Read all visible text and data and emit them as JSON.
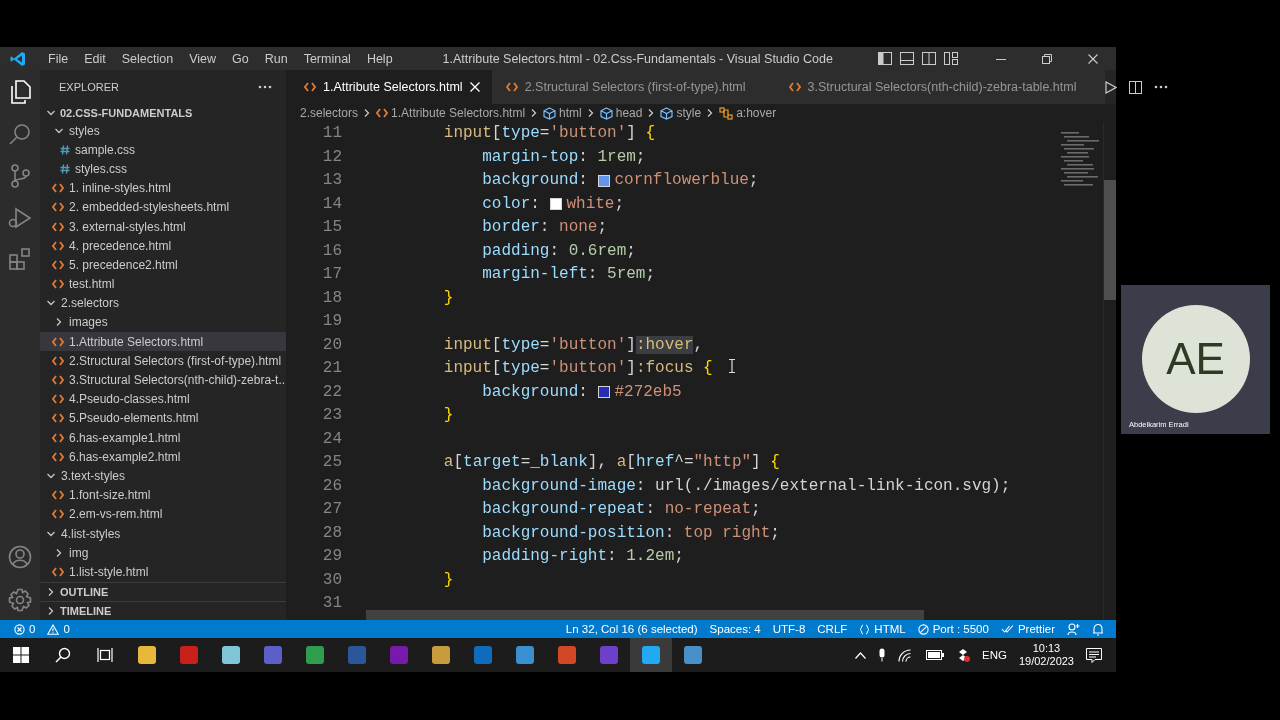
{
  "window": {
    "menu": [
      "File",
      "Edit",
      "Selection",
      "View",
      "Go",
      "Run",
      "Terminal",
      "Help"
    ],
    "title": "1.Attribute Selectors.html - 02.Css-Fundamentals - Visual Studio Code"
  },
  "explorer": {
    "title": "EXPLORER",
    "root": {
      "label": "02.CSS-FUNDAMENTALS",
      "expanded": true
    },
    "tree": [
      {
        "children": [
          {
            "label": "styles",
            "kind": "folder",
            "expanded": true,
            "selected": false,
            "children": [
              {
                "label": "sample.css",
                "kind": "css",
                "selected": false
              },
              {
                "label": "styles.css",
                "kind": "css",
                "selected": false
              }
            ]
          },
          {
            "label": "1. inline-styles.html",
            "kind": "html",
            "selected": false
          },
          {
            "label": "2. embedded-stylesheets.html",
            "kind": "html",
            "selected": false
          },
          {
            "label": "3. external-styles.html",
            "kind": "html",
            "selected": false
          },
          {
            "label": "4. precedence.html",
            "kind": "html",
            "selected": false
          },
          {
            "label": "5. precedence2.html",
            "kind": "html",
            "selected": false
          },
          {
            "label": "test.html",
            "kind": "html",
            "selected": false
          }
        ]
      },
      {
        "label": "2.selectors",
        "kind": "folder",
        "expanded": true,
        "selected": false,
        "children": [
          {
            "label": "images",
            "kind": "folder",
            "expanded": false,
            "selected": false
          },
          {
            "label": "1.Attribute Selectors.html",
            "kind": "html",
            "selected": true
          },
          {
            "label": "2.Structural Selectors (first-of-type).html",
            "kind": "html",
            "selected": false
          },
          {
            "label": "3.Structural Selectors(nth-child)-zebra-t...",
            "kind": "html",
            "selected": false
          },
          {
            "label": "4.Pseudo-classes.html",
            "kind": "html",
            "selected": false
          },
          {
            "label": "5.Pseudo-elements.html",
            "kind": "html",
            "selected": false
          },
          {
            "label": "6.has-example1.html",
            "kind": "html",
            "selected": false
          },
          {
            "label": "6.has-example2.html",
            "kind": "html",
            "selected": false
          }
        ]
      },
      {
        "label": "3.text-styles",
        "kind": "folder",
        "expanded": true,
        "selected": false,
        "children": [
          {
            "label": "1.font-size.html",
            "kind": "html",
            "selected": false
          },
          {
            "label": "2.em-vs-rem.html",
            "kind": "html",
            "selected": false
          }
        ]
      },
      {
        "label": "4.list-styles",
        "kind": "folder",
        "expanded": true,
        "selected": false,
        "children": [
          {
            "label": "img",
            "kind": "folder",
            "expanded": false,
            "selected": false
          },
          {
            "label": "1.list-style.html",
            "kind": "html",
            "selected": false
          }
        ]
      }
    ],
    "sections": [
      {
        "label": "OUTLINE",
        "expanded": false
      },
      {
        "label": "TIMELINE",
        "expanded": false
      }
    ]
  },
  "tabs": [
    {
      "label": "1.Attribute Selectors.html",
      "selected": true
    },
    {
      "label": "2.Structural Selectors (first-of-type).html",
      "selected": false
    },
    {
      "label": "3.Structural Selectors(nth-child)-zebra-table.html",
      "selected": false
    }
  ],
  "breadcrumbs": [
    {
      "label": "2.selectors",
      "kind": "folder"
    },
    {
      "label": "1.Attribute Selectors.html",
      "kind": "html"
    },
    {
      "label": "html",
      "kind": "element"
    },
    {
      "label": "head",
      "kind": "element"
    },
    {
      "label": "style",
      "kind": "element"
    },
    {
      "label": "a:hover",
      "kind": "selector"
    }
  ],
  "code": {
    "lines": [
      {
        "number": "11",
        "tokens": [
          {
            "kind": "tag",
            "text": "        input"
          },
          {
            "kind": "punct",
            "text": "["
          },
          {
            "kind": "attr",
            "text": "type"
          },
          {
            "kind": "punct",
            "text": "="
          },
          {
            "kind": "str",
            "text": "'button'"
          },
          {
            "kind": "punct",
            "text": "]"
          },
          {
            "kind": "brace",
            "text": " {"
          }
        ]
      },
      {
        "number": "12",
        "tokens": [
          {
            "kind": "prop",
            "text": "            margin-top"
          },
          {
            "kind": "punct",
            "text": ": "
          },
          {
            "kind": "num",
            "text": "1rem"
          },
          {
            "kind": "punct",
            "text": ";"
          }
        ]
      },
      {
        "number": "13",
        "tokens": [
          {
            "kind": "prop",
            "text": "            background"
          },
          {
            "kind": "punct",
            "text": ": "
          },
          {
            "kind": "swatch",
            "color": "#6495ed"
          },
          {
            "kind": "val",
            "text": "cornflowerblue"
          },
          {
            "kind": "punct",
            "text": ";"
          }
        ]
      },
      {
        "number": "14",
        "tokens": [
          {
            "kind": "prop",
            "text": "            color"
          },
          {
            "kind": "punct",
            "text": ": "
          },
          {
            "kind": "swatch",
            "color": "#ffffff"
          },
          {
            "kind": "val",
            "text": "white"
          },
          {
            "kind": "punct",
            "text": ";"
          }
        ]
      },
      {
        "number": "15",
        "tokens": [
          {
            "kind": "prop",
            "text": "            border"
          },
          {
            "kind": "punct",
            "text": ": "
          },
          {
            "kind": "val",
            "text": "none"
          },
          {
            "kind": "punct",
            "text": ";"
          }
        ]
      },
      {
        "number": "16",
        "tokens": [
          {
            "kind": "prop",
            "text": "            padding"
          },
          {
            "kind": "punct",
            "text": ": "
          },
          {
            "kind": "num",
            "text": "0.6rem"
          },
          {
            "kind": "punct",
            "text": ";"
          }
        ]
      },
      {
        "number": "17",
        "tokens": [
          {
            "kind": "prop",
            "text": "            margin-left"
          },
          {
            "kind": "punct",
            "text": ": "
          },
          {
            "kind": "num",
            "text": "5rem"
          },
          {
            "kind": "punct",
            "text": ";"
          }
        ]
      },
      {
        "number": "18",
        "tokens": [
          {
            "kind": "brace",
            "text": "        }"
          }
        ]
      },
      {
        "number": "19"
      },
      {
        "number": "20",
        "tokens": [
          {
            "kind": "tag",
            "text": "        input"
          },
          {
            "kind": "punct",
            "text": "["
          },
          {
            "kind": "attr",
            "text": "type"
          },
          {
            "kind": "punct",
            "text": "="
          },
          {
            "kind": "str",
            "text": "'button'"
          },
          {
            "kind": "punct",
            "text": "]"
          },
          {
            "kind": "pseudo-selected",
            "text": ":hover"
          },
          {
            "kind": "punct",
            "text": ","
          }
        ]
      },
      {
        "number": "21",
        "tokens": [
          {
            "kind": "tag",
            "text": "        input"
          },
          {
            "kind": "punct",
            "text": "["
          },
          {
            "kind": "attr",
            "text": "type"
          },
          {
            "kind": "punct",
            "text": "="
          },
          {
            "kind": "str",
            "text": "'button'"
          },
          {
            "kind": "punct",
            "text": "]"
          },
          {
            "kind": "pseudo",
            "text": ":focus"
          },
          {
            "kind": "brace",
            "text": " {"
          }
        ]
      },
      {
        "number": "22",
        "tokens": [
          {
            "kind": "prop",
            "text": "            background"
          },
          {
            "kind": "punct",
            "text": ": "
          },
          {
            "kind": "swatch",
            "color": "#272eb5"
          },
          {
            "kind": "val",
            "text": "#272eb5"
          }
        ]
      },
      {
        "number": "23",
        "tokens": [
          {
            "kind": "brace",
            "text": "        }"
          }
        ]
      },
      {
        "number": "24"
      },
      {
        "number": "25",
        "tokens": [
          {
            "kind": "tag",
            "text": "        a"
          },
          {
            "kind": "punct",
            "text": "["
          },
          {
            "kind": "attr",
            "text": "target"
          },
          {
            "kind": "punct",
            "text": "="
          },
          {
            "kind": "attr",
            "text": "_blank"
          },
          {
            "kind": "punct",
            "text": "], "
          },
          {
            "kind": "tag",
            "text": "a"
          },
          {
            "kind": "punct",
            "text": "["
          },
          {
            "kind": "attr",
            "text": "href"
          },
          {
            "kind": "punct",
            "text": "^="
          },
          {
            "kind": "str",
            "text": "\"http\""
          },
          {
            "kind": "punct",
            "text": "]"
          },
          {
            "kind": "brace",
            "text": " {"
          }
        ]
      },
      {
        "number": "26",
        "tokens": [
          {
            "kind": "prop",
            "text": "            background-image"
          },
          {
            "kind": "punct",
            "text": ": "
          },
          {
            "kind": "url",
            "text": "url(./images/external-link-icon.svg)"
          },
          {
            "kind": "punct",
            "text": ";"
          }
        ]
      },
      {
        "number": "27",
        "tokens": [
          {
            "kind": "prop",
            "text": "            background-repeat"
          },
          {
            "kind": "punct",
            "text": ": "
          },
          {
            "kind": "val",
            "text": "no-repeat"
          },
          {
            "kind": "punct",
            "text": ";"
          }
        ]
      },
      {
        "number": "28",
        "tokens": [
          {
            "kind": "prop",
            "text": "            background-position"
          },
          {
            "kind": "punct",
            "text": ": "
          },
          {
            "kind": "val",
            "text": "top right"
          },
          {
            "kind": "punct",
            "text": ";"
          }
        ]
      },
      {
        "number": "29",
        "tokens": [
          {
            "kind": "prop",
            "text": "            padding-right"
          },
          {
            "kind": "punct",
            "text": ": "
          },
          {
            "kind": "num",
            "text": "1.2em"
          },
          {
            "kind": "punct",
            "text": ";"
          }
        ]
      },
      {
        "number": "30",
        "tokens": [
          {
            "kind": "brace",
            "text": "        }"
          }
        ]
      },
      {
        "number": "31"
      }
    ]
  },
  "status_bar": {
    "left": [
      {
        "kind": "errors",
        "text": "0"
      },
      {
        "kind": "warnings",
        "text": "0"
      }
    ],
    "right": [
      {
        "kind": "plain",
        "text": "Ln 32, Col 16 (6 selected)"
      },
      {
        "kind": "plain",
        "text": "Spaces: 4"
      },
      {
        "kind": "plain",
        "text": "UTF-8"
      },
      {
        "kind": "plain",
        "text": "CRLF"
      },
      {
        "kind": "language",
        "text": "HTML"
      },
      {
        "kind": "port",
        "text": "Port : 5500"
      },
      {
        "kind": "prettier",
        "text": "Prettier"
      },
      {
        "kind": "feedback"
      },
      {
        "kind": "bell"
      }
    ]
  },
  "taskbar": {
    "apps": [
      {
        "color": "#e8b83a",
        "selected": false
      },
      {
        "color": "#c8201a",
        "selected": false
      },
      {
        "color": "#7fc6d8",
        "selected": false
      },
      {
        "color": "#5b5fc7",
        "selected": false
      },
      {
        "color": "#2e9d4e",
        "selected": false
      },
      {
        "color": "#2b579a",
        "selected": false
      },
      {
        "color": "#7719aa",
        "selected": false
      },
      {
        "color": "#c89b3c",
        "selected": false
      },
      {
        "color": "#0f6cbd",
        "selected": false
      },
      {
        "color": "#3a8fd1",
        "selected": false
      },
      {
        "color": "#d24726",
        "selected": false
      },
      {
        "color": "#6e40c9",
        "selected": false
      },
      {
        "color": "#23a9f2",
        "selected": true
      },
      {
        "color": "#4a90c8",
        "selected": false
      }
    ],
    "language": "ENG",
    "time": "10:13",
    "date": "19/02/2023"
  },
  "participant": {
    "initials": "AE",
    "name": "Abdelkarim Erradi"
  }
}
